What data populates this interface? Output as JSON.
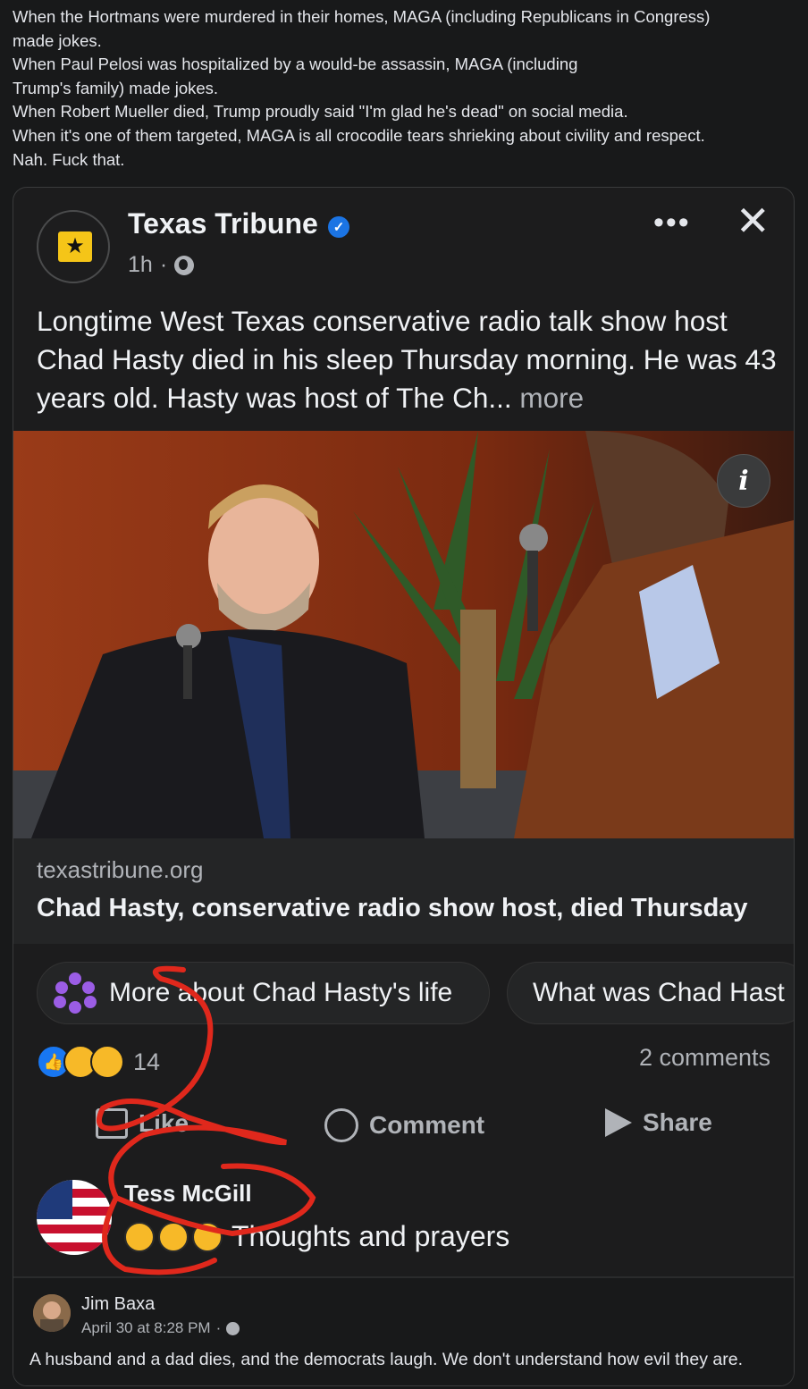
{
  "intro": {
    "lines": [
      "When the Hortmans were murdered in their homes, MAGA (including Republicans in Congress)",
      "made jokes.",
      "When Paul Pelosi was hospitalized by a would-be assassin, MAGA (including",
      "Trump's family) made jokes.",
      "When Robert Mueller died, Trump proudly said \"I'm glad he's dead\" on social media.",
      "When it's one of them targeted, MAGA is all crocodile tears shrieking about civility and respect.",
      "Nah. Fuck that."
    ]
  },
  "post": {
    "page_name": "Texas Tribune",
    "time": "1h",
    "text": "Longtime West Texas conservative radio talk show host Chad Hasty died in his sleep Thursday morning. He was 43 years old. Hasty was host of The Ch...",
    "more": "more",
    "link_domain": "texastribune.org",
    "link_title": "Chad Hasty, conservative radio show host, died Thursday",
    "chips": [
      "More about Chad Hasty's life",
      "What was Chad Hast"
    ],
    "reaction_count": "14",
    "comments_count": "2 comments",
    "actions": {
      "like": "Like",
      "comment": "Comment",
      "share": "Share"
    },
    "icons": [
      "verified-badge-icon",
      "globe-icon",
      "more-options-icon",
      "close-icon",
      "info-icon",
      "like-icon",
      "comment-icon",
      "share-icon"
    ]
  },
  "comment": {
    "name": "Tess McGill",
    "text": "Thoughts and prayers",
    "emojis": 3
  },
  "footer": {
    "name": "Jim Baxa",
    "date": "April 30 at 8:28 PM",
    "text": "A husband and a dad dies, and the democrats laugh. We don't understand how evil they are."
  },
  "colors": {
    "background": "#18191a",
    "card": "#1c1c1d",
    "accent": "#1877f2",
    "annotation": "#e0281c"
  }
}
